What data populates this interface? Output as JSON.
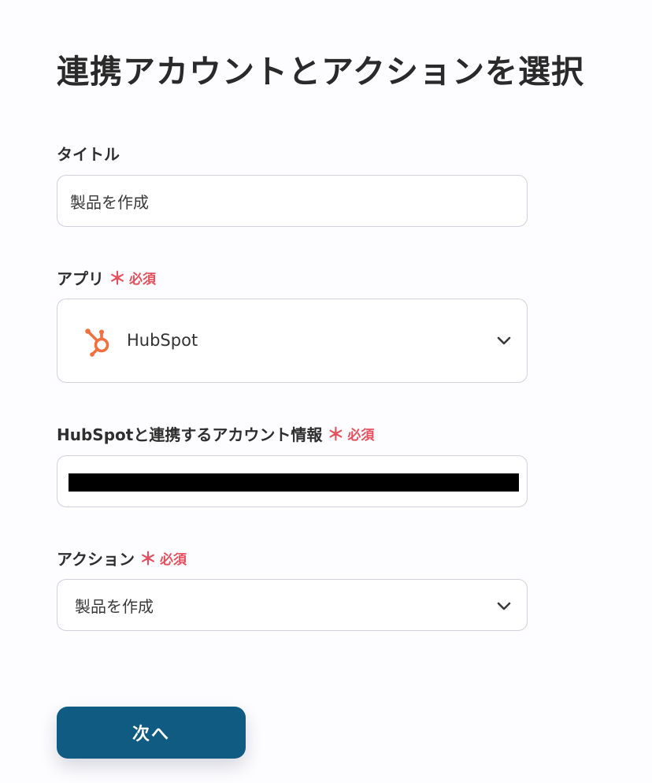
{
  "page": {
    "title": "連携アカウントとアクションを選択"
  },
  "fields": {
    "title_field": {
      "label": "タイトル",
      "value": "製品を作成"
    },
    "app_field": {
      "label": "アプリ",
      "required_mark": "＊",
      "required_text": "必須",
      "selected_app": "HubSpot",
      "logo_icon": "hubspot-logo-icon",
      "logo_color": "#f26f3e"
    },
    "account_field": {
      "label": "HubSpotと連携するアカウント情報",
      "required_mark": "＊",
      "required_text": "必須"
    },
    "action_field": {
      "label": "アクション",
      "required_mark": "＊",
      "required_text": "必須",
      "value": "製品を作成"
    }
  },
  "buttons": {
    "next_label": "次へ",
    "next_color": "#0f5b82"
  },
  "colors": {
    "required": "#e5505e",
    "border": "#d3d0dc"
  }
}
